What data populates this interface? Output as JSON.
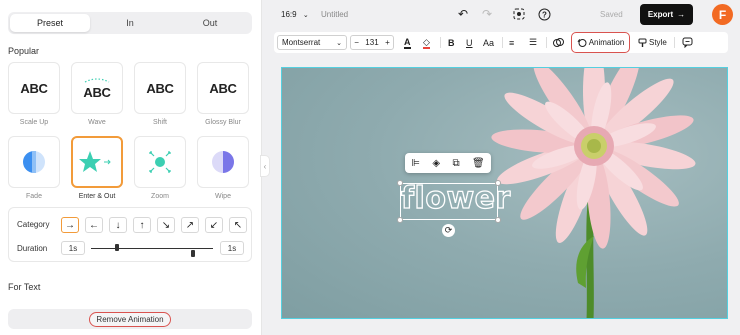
{
  "left_panel": {
    "tabs": [
      {
        "label": "Preset"
      },
      {
        "label": "In"
      },
      {
        "label": "Out"
      }
    ],
    "popular_title": "Popular",
    "presets": [
      {
        "label": "Scale Up",
        "text": "ABC"
      },
      {
        "label": "Wave",
        "text": "ABC"
      },
      {
        "label": "Shift",
        "text": "ABC"
      },
      {
        "label": "Glossy Blur",
        "text": "ABC"
      },
      {
        "label": "Fade"
      },
      {
        "label": "Enter & Out"
      },
      {
        "label": "Zoom"
      },
      {
        "label": "Wipe"
      }
    ],
    "category_label": "Category",
    "directions": [
      "→",
      "←",
      "↓",
      "↑",
      "↘",
      "↗",
      "↙",
      "↖"
    ],
    "duration_label": "Duration",
    "duration_start": "1s",
    "duration_end": "1s",
    "duration_start_level": 0.2,
    "duration_end_level": 0.82,
    "for_text_title": "For Text",
    "remove_label": "Remove Animation"
  },
  "topbar": {
    "ratio": "16:9",
    "title": "Untitled",
    "saved": "Saved",
    "export_label": "Export",
    "logo_letter": "F"
  },
  "toolbar": {
    "font": "Montserrat",
    "size": "131",
    "minus": "−",
    "plus": "+",
    "animation_label": "Animation",
    "style_label": "Style"
  },
  "canvas": {
    "text": "flower",
    "border_color": "#54d0e0"
  },
  "colors": {
    "accent": "#f29b3a",
    "highlight": "#d9534f",
    "teal": "#3ccfb2",
    "blue": "#3b8ff0",
    "purple": "#7a76e8"
  }
}
